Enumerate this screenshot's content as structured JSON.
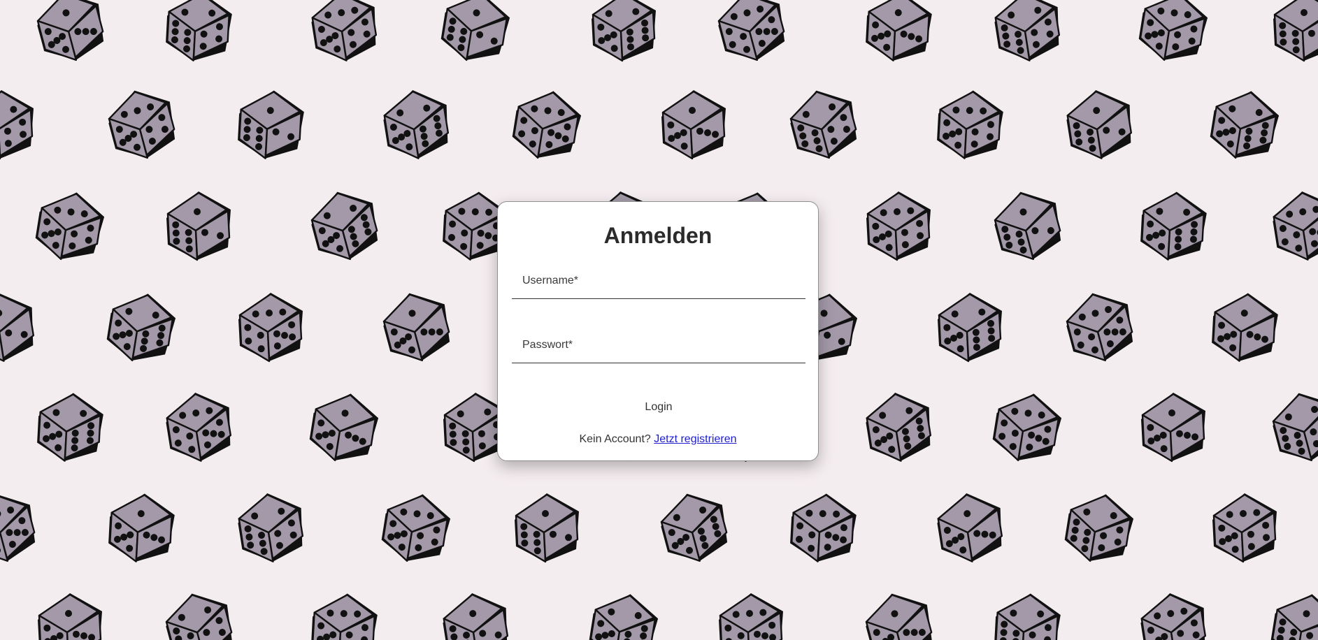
{
  "colors": {
    "background": "#f4edf0",
    "dice_fill": "#a399a8",
    "dice_outline": "#111111",
    "card": "#ffffff",
    "link": "#2020d0"
  },
  "background": {
    "pattern": "dice-icon"
  },
  "login_card": {
    "title": "Anmelden",
    "username": {
      "label": "Username*",
      "value": ""
    },
    "password": {
      "label": "Passwort*",
      "value": ""
    },
    "login_button": "Login",
    "no_account_text": "Kein Account?",
    "register_link": "Jetzt registrieren"
  }
}
